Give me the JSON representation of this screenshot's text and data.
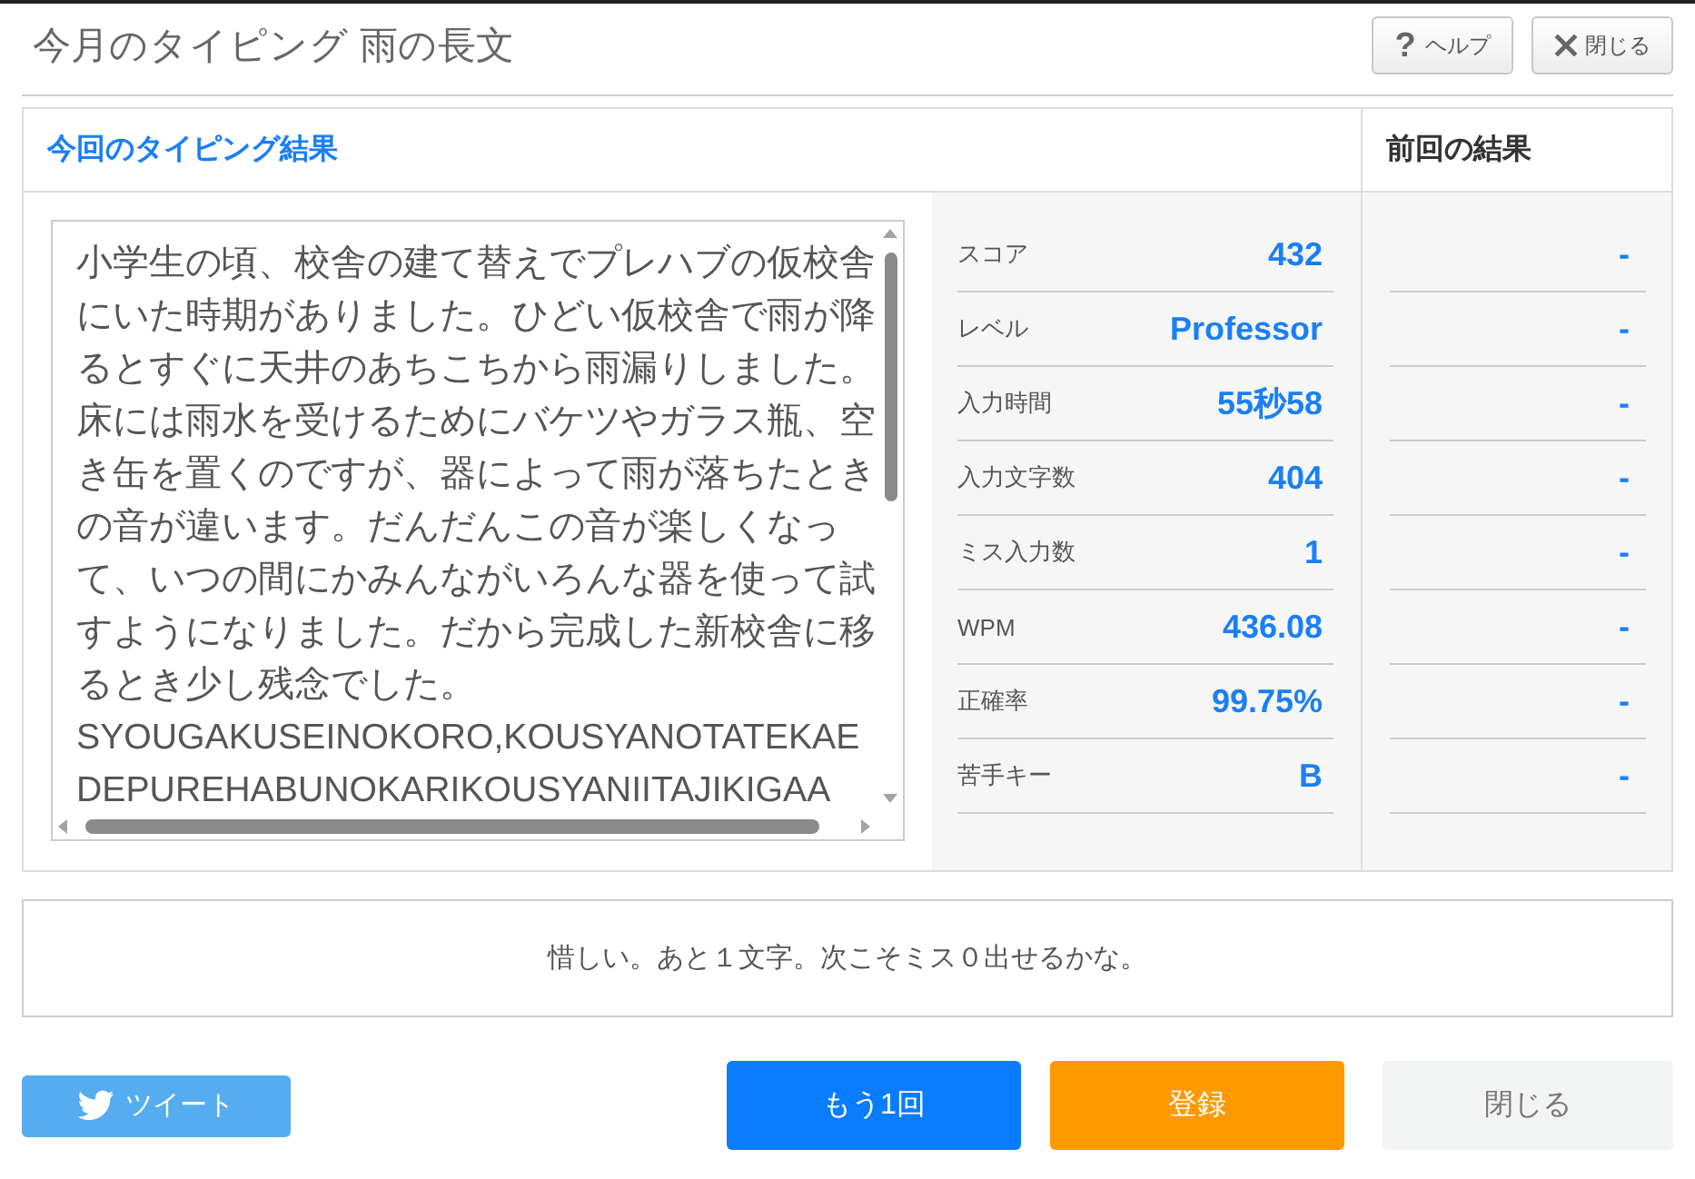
{
  "title": "今月のタイピング 雨の長文",
  "header_buttons": [
    {
      "kind": "help",
      "icon": "?",
      "label": "ヘルプ"
    },
    {
      "kind": "close",
      "label": "閉じる"
    }
  ],
  "results": {
    "current_heading": "今回のタイピング結果",
    "previous_heading": "前回の結果",
    "passage": {
      "text": "小学生の頃、校舎の建て替えでプレハブの仮校舎にいた時期がありました。ひどい仮校舎で雨が降るとすぐに天井のあちこちから雨漏りしました。床には雨水を受けるためにバケツやガラス瓶、空き缶を置くのですが、器によって雨が落ちたときの音が違います。だんだんこの音が楽しくなって、いつの間にかみんながいろんな器を使って試すようになりました。だから完成した新校舎に移るとき少し残念でした。",
      "romaji": "SYOUGAKUSEINOKORO,KOUSYANOTATEKAEDEPUREHABUNOKARIKOUSYANIITAJIKIGAA"
    },
    "stats": [
      {
        "label": "スコア",
        "value": "432",
        "previous": "-"
      },
      {
        "label": "レベル",
        "value": "Professor",
        "previous": "-"
      },
      {
        "label": "入力時間",
        "value": "55秒58",
        "previous": "-"
      },
      {
        "label": "入力文字数",
        "value": "404",
        "previous": "-"
      },
      {
        "label": "ミス入力数",
        "value": "1",
        "previous": "-"
      },
      {
        "label": "WPM",
        "value": "436.08",
        "previous": "-"
      },
      {
        "label": "正確率",
        "value": "99.75%",
        "previous": "-"
      },
      {
        "label": "苦手キー",
        "value": "B",
        "previous": "-"
      }
    ]
  },
  "message": "惜しい。あと１文字。次こそミス０出せるかな。",
  "footer_buttons": [
    {
      "kind": "tweet",
      "label": "ツイート"
    },
    {
      "kind": "retry",
      "label": "もう1回"
    },
    {
      "kind": "register",
      "label": "登録"
    },
    {
      "kind": "close",
      "label": "閉じる"
    }
  ]
}
